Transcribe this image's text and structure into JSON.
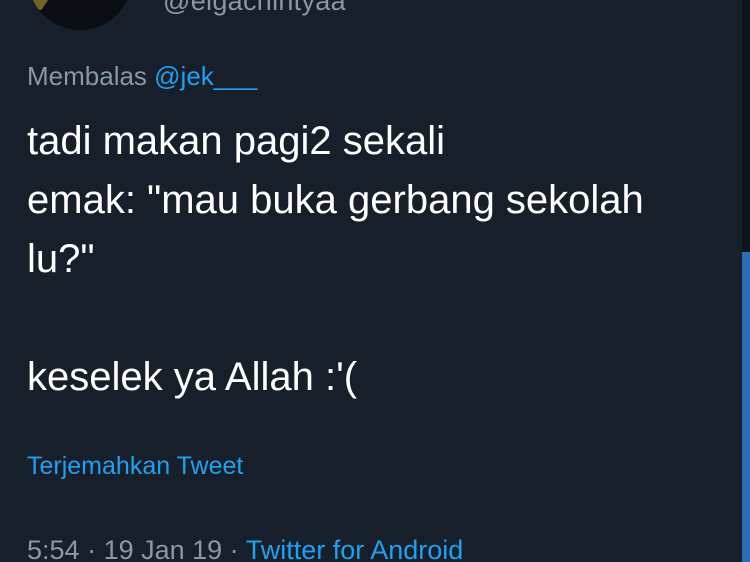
{
  "tweet": {
    "handle": "@elgachintyaa",
    "reply_prefix": "Membalas ",
    "reply_to": "@jek___",
    "body": "tadi makan pagi2 sekali\nemak: \"mau buka gerbang sekolah\nlu?\"\n\nkeselek ya Allah :'(",
    "translate_label": "Terjemahkan Tweet",
    "time": "5:54",
    "date": "19 Jan 19",
    "separator": " · ",
    "source": "Twitter for Android"
  },
  "colors": {
    "background": "#161f2a",
    "text": "#ffffff",
    "muted": "#8899a6",
    "link": "#1da1f2"
  }
}
